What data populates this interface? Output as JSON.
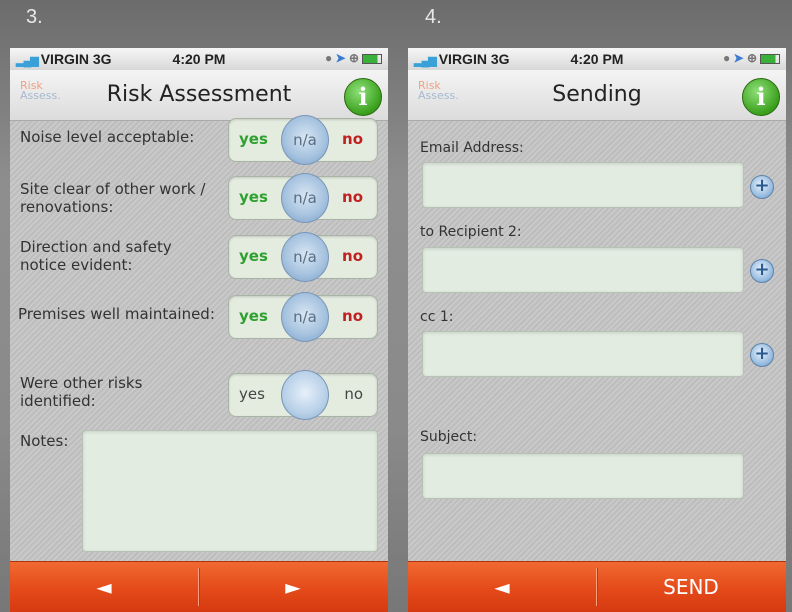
{
  "panels": {
    "left_number": "3.",
    "right_number": "4."
  },
  "status_bar": {
    "carrier": "VIRGIN 3G",
    "time": "4:20 PM"
  },
  "logo": {
    "line1": "Risk",
    "line2": "Assess."
  },
  "screen3": {
    "title": "Risk Assessment",
    "info_label": "i",
    "rows": [
      {
        "label": "Noise level acceptable:",
        "yes": "yes",
        "na": "n/a",
        "no": "no"
      },
      {
        "label": "Site clear of other work / renovations:",
        "yes": "yes",
        "na": "n/a",
        "no": "no"
      },
      {
        "label": "Direction and safety notice evident:",
        "yes": "yes",
        "na": "n/a",
        "no": "no"
      },
      {
        "label": "Premises well maintained:",
        "yes": "yes",
        "na": "n/a",
        "no": "no"
      },
      {
        "label": "Were other risks identified:",
        "yes": "yes",
        "na": "",
        "no": "no"
      }
    ],
    "notes_label": "Notes:",
    "notes_value": "",
    "back_label": "◄",
    "next_label": "►"
  },
  "screen4": {
    "title": "Sending",
    "info_label": "i",
    "fields": [
      {
        "label": "Email Address:",
        "value": ""
      },
      {
        "label": "to Recipient 2:",
        "value": ""
      },
      {
        "label": "cc 1:",
        "value": ""
      },
      {
        "label": "Subject:",
        "value": ""
      }
    ],
    "plus_label": "+",
    "back_label": "◄",
    "send_label": "SEND"
  },
  "colors": {
    "yes": "#2ea02e",
    "no": "#c02020",
    "bottom_bar": "#e44a1a",
    "info_button": "#3aa01c"
  }
}
